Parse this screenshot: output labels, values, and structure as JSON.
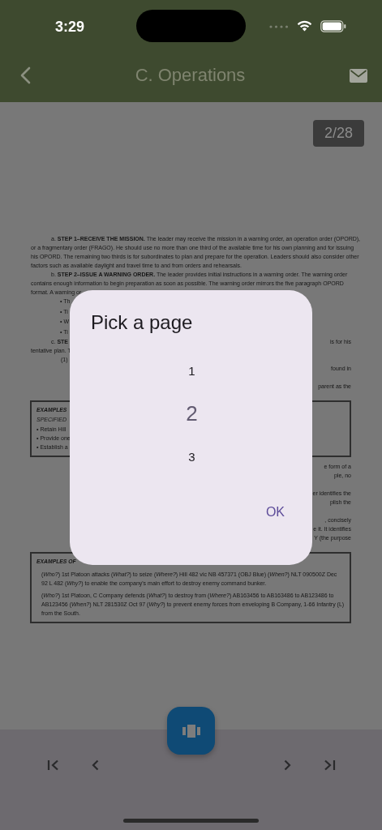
{
  "status_bar": {
    "time": "3:29"
  },
  "header": {
    "title": "C. Operations"
  },
  "page_counter": "2/28",
  "document": [
    {
      "kind": "lines",
      "lines": [
        {
          "kind": "lead",
          "left": "a. **STEP 1–RECEIVE THE MISSION.** The leader may receive the mission in a warning order, an operation order (OPORD),"
        },
        {
          "kind": "text",
          "left": "or a fragmentary order (FRAGO). He should use no more than one third of the available time for his own planning and for issuing"
        },
        {
          "kind": "text",
          "left": "his OPORD. The remaining two thirds is for subordinates to plan and prepare for the operation. Leaders should also consider other"
        },
        {
          "kind": "text",
          "left": "factors such as available daylight and travel time to and from orders and rehearsals."
        },
        {
          "kind": "lead",
          "left": "b. **STEP 2–ISSUE A WARNING ORDER.** The leader provides initial instructions in a warning order. The warning order"
        },
        {
          "kind": "text",
          "left": "contains enough information to begin preparation as soon as possible. The warning order mirrors the five paragraph OPORD"
        },
        {
          "kind": "text",
          "left": "format. A warning or"
        },
        {
          "kind": "bullet",
          "left": "• Th"
        },
        {
          "kind": "bullet",
          "left": "• Ti"
        },
        {
          "kind": "bullet",
          "left": "• W"
        },
        {
          "kind": "bullet",
          "left": "• Ti"
        },
        {
          "kind": "lead",
          "left": "c. **STE**",
          "right": "is for his"
        },
        {
          "kind": "text",
          "left": "tentative plan. T"
        },
        {
          "kind": "sub",
          "left": "(1)"
        },
        {
          "kind": "text",
          "right": "found in"
        }
      ]
    },
    {
      "kind": "lines",
      "lines": [
        {
          "kind": "text",
          "right": "parent as the"
        }
      ]
    },
    {
      "kind": "box",
      "heading": "EXAMPLES",
      "items": [
        {
          "kind": "subhead",
          "text": "SPECIFIED"
        },
        {
          "kind": "bullet",
          "text": "• Retain Hill"
        },
        {
          "kind": "bullet",
          "text": "• Provide one"
        },
        {
          "kind": "bullet",
          "text": "• Establish a"
        }
      ]
    },
    {
      "kind": "lines",
      "lines": [
        {
          "kind": "text",
          "right": "e form of a"
        },
        {
          "kind": "text",
          "right": "ple, no"
        }
      ]
    },
    {
      "kind": "lines",
      "lines": [
        {
          "kind": "text",
          "right": "er identifies the"
        },
        {
          "kind": "text",
          "right": "plish the"
        }
      ]
    },
    {
      "kind": "lines",
      "lines": [
        {
          "kind": "text",
          "right": ", concisely"
        },
        {
          "kind": "text",
          "right": "e it. It identifies"
        },
        {
          "kind": "text",
          "right": "Y (the purpose"
        }
      ]
    },
    {
      "kind": "box",
      "heading": "EXAMPLES OF",
      "items": [
        {
          "kind": "para",
          "text": "(*Who?*) 1st Platoon attacks (*What?*) to seize (*Where?*) Hill 482 vic NB 457371 (OBJ Blue) (*When?*) NLT 090500Z Dec 92 L 482 (*Why?*) to enable the company's main effort to destroy enemy command bunker."
        },
        {
          "kind": "para",
          "text": "(*Who?*) 1st Platoon, C Company defends (*What?*) to destroy from (*Where?*) AB163456 to AB163486 to AB123486 to AB123456 (*When?*) NLT 281530Z Oct 97 (*Why?*) to prevent enemy forces from enveloping B Company, 1-66 Infantry (L) from the South."
        }
      ]
    }
  ],
  "dialog": {
    "title": "Pick a page",
    "options": [
      {
        "label": "1",
        "selected": false
      },
      {
        "label": "2",
        "selected": true
      },
      {
        "label": "3",
        "selected": false
      }
    ],
    "ok": "OK"
  }
}
